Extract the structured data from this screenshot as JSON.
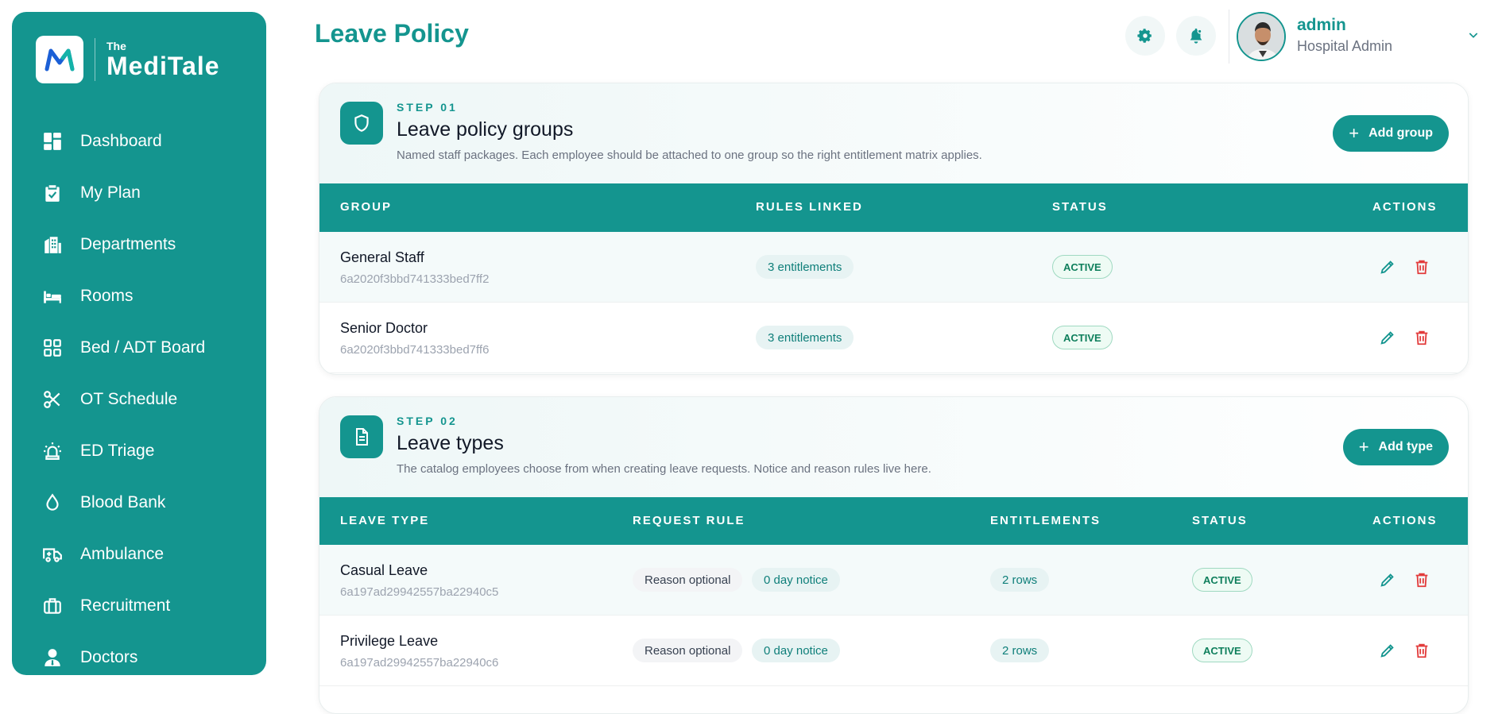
{
  "brand": {
    "logo_text": "M",
    "the": "The",
    "name": "MediTale"
  },
  "sidebar": {
    "items": [
      {
        "label": "Dashboard",
        "icon": "dashboard-icon"
      },
      {
        "label": "My Plan",
        "icon": "clipboard-check-icon"
      },
      {
        "label": "Departments",
        "icon": "building-icon"
      },
      {
        "label": "Rooms",
        "icon": "bed-icon"
      },
      {
        "label": "Bed / ADT Board",
        "icon": "grid-icon"
      },
      {
        "label": "OT Schedule",
        "icon": "scissors-icon"
      },
      {
        "label": "ED Triage",
        "icon": "siren-icon"
      },
      {
        "label": "Blood Bank",
        "icon": "droplet-icon"
      },
      {
        "label": "Ambulance",
        "icon": "ambulance-icon"
      },
      {
        "label": "Recruitment",
        "icon": "briefcase-icon"
      },
      {
        "label": "Doctors",
        "icon": "doctor-icon"
      }
    ]
  },
  "header": {
    "title": "Leave Policy",
    "user": {
      "name": "admin",
      "role": "Hospital Admin"
    }
  },
  "groups_section": {
    "step": "STEP 01",
    "title": "Leave policy groups",
    "description": "Named staff packages. Each employee should be attached to one group so the right entitlement matrix applies.",
    "add_label": "Add group",
    "columns": [
      "GROUP",
      "RULES LINKED",
      "STATUS",
      "ACTIONS"
    ],
    "rows": [
      {
        "name": "General Staff",
        "id": "6a2020f3bbd741333bed7ff2",
        "rules": "3 entitlements",
        "status": "ACTIVE"
      },
      {
        "name": "Senior Doctor",
        "id": "6a2020f3bbd741333bed7ff6",
        "rules": "3 entitlements",
        "status": "ACTIVE"
      }
    ]
  },
  "types_section": {
    "step": "STEP 02",
    "title": "Leave types",
    "description": "The catalog employees choose from when creating leave requests. Notice and reason rules live here.",
    "add_label": "Add type",
    "columns": [
      "LEAVE TYPE",
      "REQUEST RULE",
      "ENTITLEMENTS",
      "STATUS",
      "ACTIONS"
    ],
    "rows": [
      {
        "name": "Casual Leave",
        "id": "6a197ad29942557ba22940c5",
        "reason": "Reason optional",
        "notice": "0 day notice",
        "entitlements": "2 rows",
        "status": "ACTIVE"
      },
      {
        "name": "Privilege Leave",
        "id": "6a197ad29942557ba22940c6",
        "reason": "Reason optional",
        "notice": "0 day notice",
        "entitlements": "2 rows",
        "status": "ACTIVE"
      }
    ]
  },
  "colors": {
    "accent": "#14958f",
    "danger": "#e23b3b",
    "active_badge": "#0f7f5c"
  }
}
